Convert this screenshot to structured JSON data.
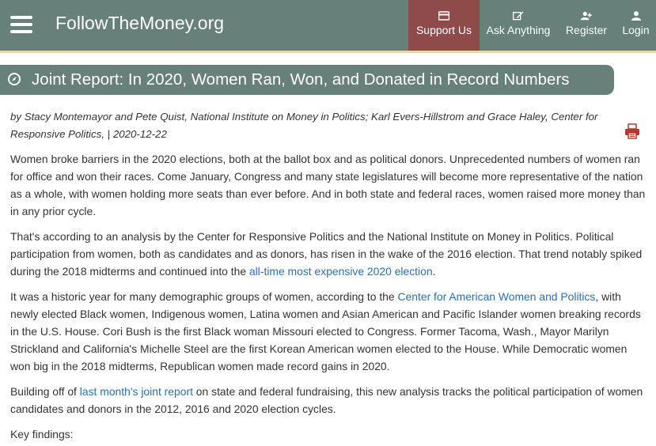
{
  "header": {
    "brand": "FollowTheMoney.org",
    "nav": {
      "support_label": "Support Us",
      "ask_label": "Ask Anything",
      "register_label": "Register",
      "login_label": "Login"
    }
  },
  "article": {
    "title": "Joint Report: In 2020, Women Ran, Won, and Donated in Record Numbers",
    "byline": "by Stacy Montemayor and Pete Quist, National Institute on Money in Politics; Karl Evers-Hillstrom and Grace Haley, Center for Responsive Politics, | 2020-12-22",
    "p1": "Women broke barriers in the 2020 elections, both at the ballot box and as political donors. Unprecedented numbers of women ran for office and won their races. Come January, Congress and many state legislatures will become more representative of the nation as a whole, with women holding more seats than ever before. And in both state and federal races, women raised more money than in any prior cycle.",
    "p2_before": "That's according to an analysis by the Center for Responsive Politics and the National Institute on Money in Politics. Political participation from women, both as candidates and as donors, has risen in the wake of the 2016 election. That trend notably spiked during the 2018 midterms and continued into the ",
    "p2_link": "all-time most expensive 2020 election",
    "p2_after": ".",
    "p3_before": "It was a historic year for many demographic groups of women, according to the ",
    "p3_link": "Center for American Women and Politics",
    "p3_after": ", with newly elected Black women, Indigenous women, Latina women and Asian American and Pacific Islander women breaking records in the U.S. House. Cori Bush is the first Black woman Missouri elected to Congress. Former Tacoma, Wash., Mayor Marilyn Strickland and California's Michelle Steel are the first Korean American women elected to the House. While Democratic women won big in the 2018 midterms, Republican women made record gains in 2020.",
    "p4_before": "Building off of ",
    "p4_link": "last month's joint report",
    "p4_after": " on state and federal fundraising, this new analysis tracks the political participation of women candidates and donors in the 2012, 2016 and 2020 election cycles.",
    "p5": "Key findings:"
  },
  "colors": {
    "nav_bg": "#67807a",
    "support_bg": "#8f4a4a",
    "link": "#2a6fb5",
    "print": "#b5372f"
  },
  "icons": [
    "hamburger-icon",
    "card-icon",
    "edit-icon",
    "add-user-icon",
    "user-icon",
    "compass-icon",
    "print-icon"
  ]
}
